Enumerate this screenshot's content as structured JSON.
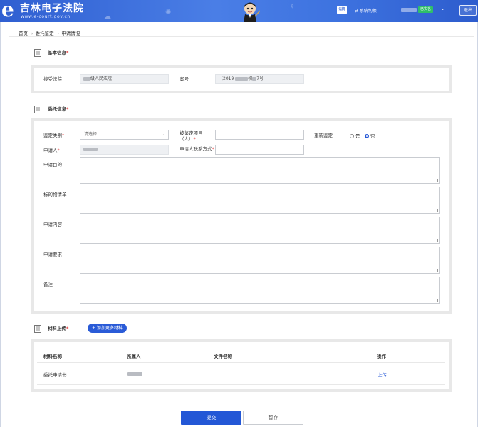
{
  "header": {
    "site_title": "吉林电子法院",
    "site_url": "www.e-court.gov.cn",
    "badge_label": "法院",
    "switch_label": "⇄ 系统切换",
    "user_tag": "已实名",
    "logout_label": "退出"
  },
  "breadcrumb": {
    "items": [
      "首页",
      "委托鉴定",
      "申请情况"
    ]
  },
  "basic_info": {
    "title": "基本信息",
    "court_label": "接受法院",
    "court_value_visible": "级人民法院",
    "case_no_label": "案号",
    "case_no_prefix": "（2019",
    "case_no_mid": "初",
    "case_no_suffix": "7号"
  },
  "entrust_info": {
    "title": "委托信息",
    "appraisal_type_label": "鉴定类别",
    "appraisal_type_placeholder": "请选择",
    "appraised_item_label": "被鉴定项目（人）",
    "reappraisal_label": "重新鉴定",
    "radio_yes": "是",
    "radio_no": "否",
    "applicant_label": "申请人",
    "applicant_contact_label": "申请人联系方式",
    "purpose_label": "申请目的",
    "subject_list_label": "标的物清单",
    "content_label": "申请内容",
    "requirement_label": "申请要求",
    "remark_label": "备注"
  },
  "materials": {
    "title": "材料上传",
    "add_button": "+ 添加更多材料",
    "columns": [
      "材料名称",
      "所属人",
      "文件名称",
      "操作"
    ],
    "rows": [
      {
        "name": "委托申请书",
        "action": "上传"
      }
    ]
  },
  "actions": {
    "submit": "提交",
    "save": "暂存"
  },
  "colors": {
    "header_blue": "#3e73e0",
    "primary_button": "#2357d6",
    "required_mark": "#e03b3b",
    "link": "#2a5bd7"
  }
}
